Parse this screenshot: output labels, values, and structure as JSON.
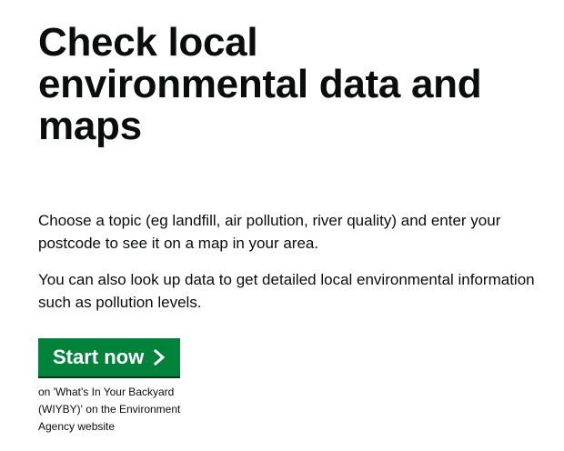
{
  "page": {
    "title": "Check local environmental data and maps",
    "paragraphs": [
      "Choose a topic (eg landfill, air pollution, river quality) and enter your postcode to see it on a map in your area.",
      "You can also look up data to get detailed local environmental information such as pollution levels."
    ],
    "start_button": {
      "label": "Start now",
      "icon": "chevron-right-icon",
      "color": "#00823b"
    },
    "button_note": "on 'What's In Your Backyard (WIYBY)' on the Environment Agency website"
  }
}
